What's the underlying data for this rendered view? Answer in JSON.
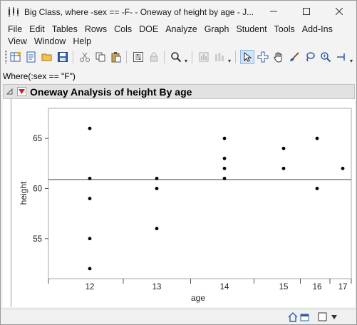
{
  "window": {
    "title": "Big Class, where -sex == -F- - Oneway of height by age - J..."
  },
  "menus": {
    "row1": [
      "File",
      "Edit",
      "Tables",
      "Rows",
      "Cols",
      "DOE",
      "Analyze",
      "Graph",
      "Student",
      "Tools",
      "Add-Ins"
    ],
    "row2": [
      "View",
      "Window",
      "Help"
    ]
  },
  "toolbar": {
    "icons": [
      "new-data-table-icon",
      "new-script-icon",
      "open-icon",
      "save-icon",
      "cut-icon",
      "copy-icon",
      "paste-icon",
      "data-filter-icon",
      "lock-icon",
      "search-icon",
      "report-icon",
      "columns-icon",
      "arrow-tool-icon",
      "crosshair-tool-icon",
      "hand-tool-icon",
      "brush-tool-icon",
      "lasso-tool-icon",
      "magnifier-tool-icon",
      "annotate-tool-icon"
    ]
  },
  "report": {
    "where_clause": "Where(:sex == \"F\")",
    "outline_title": "Oneway Analysis of height By age"
  },
  "chart_data": {
    "type": "scatter",
    "xlabel": "age",
    "ylabel": "height",
    "categories": [
      "12",
      "13",
      "14",
      "15",
      "16",
      "17"
    ],
    "ylim": [
      51,
      68
    ],
    "yticks": [
      55,
      60,
      65
    ],
    "grand_mean": 60.9,
    "points": [
      {
        "x": "12",
        "y": 66
      },
      {
        "x": "12",
        "y": 61
      },
      {
        "x": "12",
        "y": 59
      },
      {
        "x": "12",
        "y": 55
      },
      {
        "x": "12",
        "y": 52
      },
      {
        "x": "13",
        "y": 61
      },
      {
        "x": "13",
        "y": 60
      },
      {
        "x": "13",
        "y": 56
      },
      {
        "x": "14",
        "y": 65
      },
      {
        "x": "14",
        "y": 63
      },
      {
        "x": "14",
        "y": 62
      },
      {
        "x": "14",
        "y": 61
      },
      {
        "x": "15",
        "y": 64
      },
      {
        "x": "15",
        "y": 62
      },
      {
        "x": "16",
        "y": 65
      },
      {
        "x": "16",
        "y": 60
      },
      {
        "x": "17",
        "y": 62
      }
    ]
  },
  "colors": {
    "accent_red": "#d0202a",
    "selected_tool": "#cfe3fb"
  }
}
